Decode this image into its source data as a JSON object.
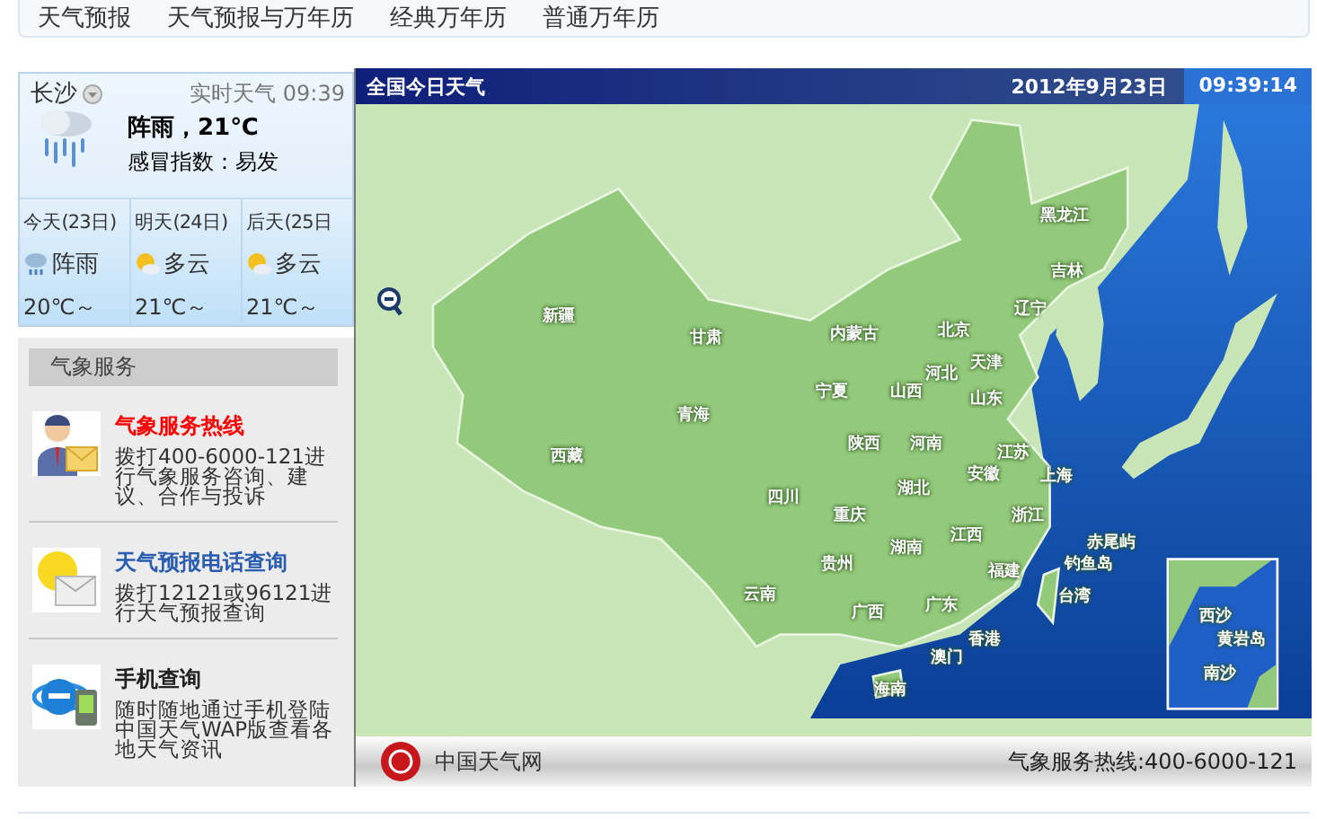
{
  "nav": {
    "items": [
      {
        "label": "天气预报"
      },
      {
        "label": "天气预报与万年历"
      },
      {
        "label": "经典万年历"
      },
      {
        "label": "普通万年历"
      }
    ]
  },
  "weather": {
    "city": "长沙",
    "realtime_label": "实时天气 09:39",
    "condition": "阵雨，21℃",
    "flu_index": "感冒指数：易发",
    "days": [
      {
        "label": "今天(23日)",
        "kind": "rain",
        "condition": "阵雨",
        "temp": "20℃～"
      },
      {
        "label": "明天(24日)",
        "kind": "cloudy",
        "condition": "多云",
        "temp": "21℃～"
      },
      {
        "label": "后天(25日",
        "kind": "cloudy",
        "condition": "多云",
        "temp": "21℃～"
      }
    ]
  },
  "services": {
    "title": "气象服务",
    "items": [
      {
        "kind": "hotline",
        "title": "气象服务热线",
        "color": "#ff0000",
        "text": "拨打400-6000-121进行气象服务咨询、建议、合作与投诉"
      },
      {
        "kind": "phone",
        "title": "天气预报电话查询",
        "color": "#2a5db0",
        "text": "拨打12121或96121进行天气预报查询"
      },
      {
        "kind": "mobile",
        "title": "手机查询",
        "color": "#222222",
        "text": "随时随地通过手机登陆中国天气WAP版查看各地天气资讯"
      }
    ]
  },
  "map": {
    "title": "全国今日天气",
    "date": "2012年9月23日",
    "time": "09:39:14",
    "labels": [
      "黑龙江",
      "吉林",
      "辽宁",
      "新疆",
      "甘肃",
      "内蒙古",
      "北京",
      "天津",
      "河北",
      "宁夏",
      "山西",
      "山东",
      "青海",
      "陕西",
      "河南",
      "西藏",
      "江苏",
      "安徽",
      "上海",
      "四川",
      "湖北",
      "重庆",
      "浙江",
      "湖南",
      "江西",
      "赤尾屿",
      "贵州",
      "福建",
      "钓鱼岛",
      "云南",
      "广西",
      "广东",
      "台湾",
      "西沙",
      "香港",
      "黄岩岛",
      "澳门",
      "海南",
      "南沙"
    ],
    "site_name": "中国天气网",
    "hotline": "气象服务热线:400-6000-121"
  }
}
